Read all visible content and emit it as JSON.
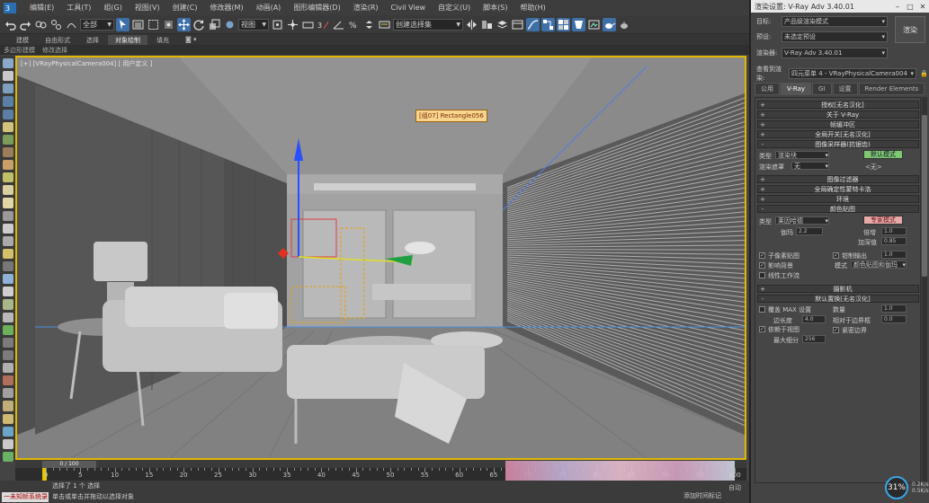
{
  "menubar": {
    "items": [
      "编辑(E)",
      "工具(T)",
      "组(G)",
      "视图(V)",
      "创建(C)",
      "修改器(M)",
      "动画(A)",
      "图形编辑器(D)",
      "渲染(R)",
      "Civil View",
      "自定义(U)",
      "脚本(S)",
      "帮助(H)"
    ]
  },
  "toolbar": {
    "selection_filter": "全部",
    "view_combo": "视图",
    "named_selection": "创建选择集"
  },
  "ribbon": {
    "tabs": [
      "建模",
      "自由形式",
      "选择",
      "对象绘制",
      "填充"
    ],
    "active_index": 3,
    "sub_items": [
      "多边形建模",
      "修改选择"
    ]
  },
  "viewport": {
    "label": "[+] [VRayPhysicalCamera004] [ 用户定义 ]",
    "tooltip": "[组07] Rectangle056"
  },
  "timeline": {
    "slider": "0 / 100",
    "ticks": [
      "0",
      "5",
      "10",
      "15",
      "20",
      "25",
      "30",
      "35",
      "40",
      "45",
      "50",
      "55",
      "60",
      "65",
      "70",
      "75",
      "80",
      "85",
      "90",
      "95",
      "100"
    ]
  },
  "status": {
    "left": "一未知帧系统录",
    "msg1": "选择了 1 个 选择",
    "msg2": "单击或单击并拖动以选择对象",
    "add_time": "添加时间标记",
    "right": "自动"
  },
  "dialog": {
    "title": "渲染设置: V-Ray Adv 3.40.01",
    "target_label": "目标:",
    "target_value": "产品级渲染模式",
    "preset_label": "预设:",
    "preset_value": "未选定预设",
    "renderer_label": "渲染器:",
    "renderer_value": "V-Ray Adv 3.40.01",
    "render_button": "渲染",
    "view_label": "查看到渲染:",
    "view_value": "四元菜单 4 - VRayPhysicalCamera004",
    "tabs": [
      "公用",
      "V-Ray",
      "GI",
      "设置",
      "Render Elements"
    ],
    "active_tab": 1,
    "rollouts": {
      "auth": "授权[无名汉化]",
      "about": "关于 V-Ray",
      "framebuffer": "帧缓冲区",
      "global": "全局开关[无名汉化]",
      "image_sampler": "图像采样器(抗锯齿)",
      "image_filter": "图像过滤器",
      "global_dmc": "全局确定性蒙特卡洛",
      "env": "环境",
      "color_mapping": "颜色贴图",
      "camera": "摄影机",
      "default_displacement": "默认置换[无名汉化]"
    },
    "sampler": {
      "type_label": "类型",
      "type_value": "渲染块",
      "mode_button": "默认模式",
      "mask_label": "渲染遮罩",
      "mask_value": "无",
      "min_shading": "<无>"
    },
    "color_map": {
      "type_label": "类型",
      "type_value": "莱因哈德",
      "expert_button": "专家模式",
      "gamma_label": "伽玛",
      "gamma_value": "2.2",
      "burn_label": "倍增",
      "burn_value": "1.0",
      "mult_label": "加深值",
      "mult_value": "0.85",
      "subpixel": "子像素贴图",
      "clamp": "钳制输出",
      "clamp_value": "1.0",
      "affect_bg": "影响背景",
      "mode_label": "模式",
      "mode_value": "颜色贴图和伽玛",
      "linear": "线性工作流"
    },
    "displacement": {
      "override": "覆盖 MAX 设置",
      "edge_length": "边长度",
      "edge_value": "4.0",
      "view_dependent": "依赖于视图",
      "max_subdivs": "最大细分",
      "max_subdivs_value": "256",
      "amount_label": "数量",
      "amount_value": "1.0",
      "tight_bounds": "紧密边界",
      "relative_bbox": "相对于边界框",
      "relative_value": "0.0"
    }
  },
  "perf": {
    "percent": "31%",
    "side_lines": [
      "0.2K/s",
      "0.5K/s"
    ]
  },
  "colors": {
    "selection_yellow": "#e0b800",
    "active_blue": "#3f6fa7",
    "tooltip_bg": "#f6d58d",
    "pink_button": "#e8a9a9",
    "green_button": "#7ec96f"
  }
}
